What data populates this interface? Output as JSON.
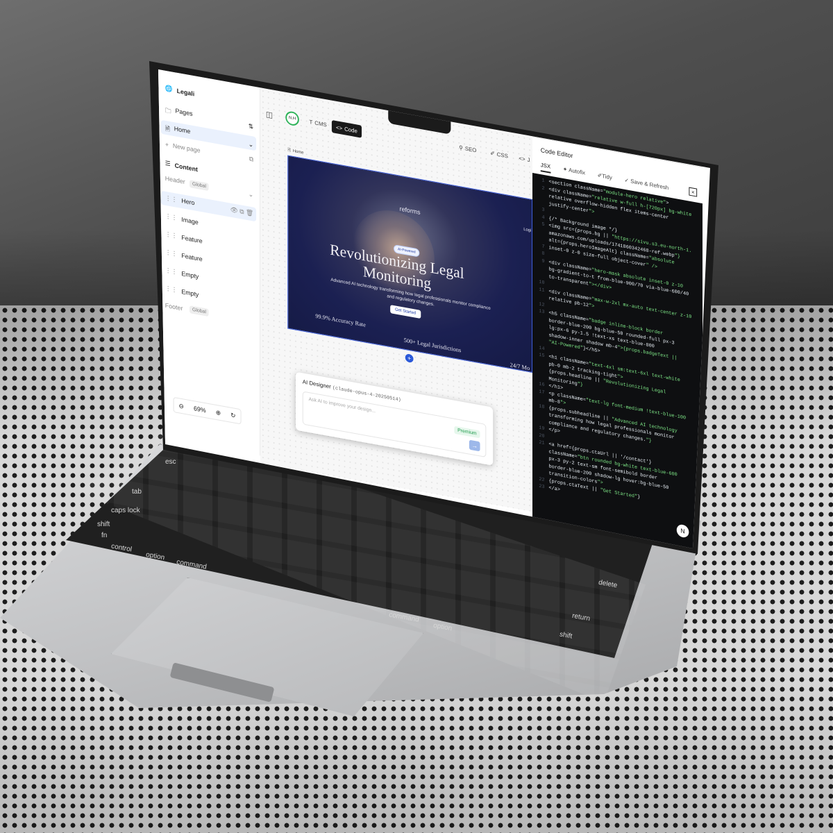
{
  "app": {
    "site_name": "Legali"
  },
  "sidebar": {
    "pages_label": "Pages",
    "home_label": "Home",
    "new_page_label": "New page",
    "content_label": "Content",
    "header_label": "Header",
    "footer_label": "Footer",
    "global_label": "Global",
    "layers": [
      "Hero",
      "Image",
      "Feature",
      "Feature",
      "Empty",
      "Empty"
    ],
    "zoom": "69%"
  },
  "topbar": {
    "avatar_initials": "N.H",
    "cms_label": "CMS",
    "code_label": "Code",
    "seo_label": "SEO",
    "css_label": "CSS",
    "js_label": "J"
  },
  "canvas": {
    "frame_label": "Home",
    "hero": {
      "brand": "reforms",
      "login": "Logi",
      "badge": "AI-Powered",
      "title_line1": "Revolutionizing Legal",
      "title_line2": "Monitoring",
      "subtitle": "Advanced AI technology transforming how legal professionals monitor compliance and regulatory changes.",
      "cta": "Get Started",
      "stats": [
        "99.9% Accuracy Rate",
        "500+ Legal Jurisdictions",
        "24/7 Mo"
      ]
    },
    "ai_designer": {
      "title": "AI Designer",
      "model": "(claude-opus-4-20250514)",
      "placeholder": "Ask AI to improve your design...",
      "premium": "Premium"
    }
  },
  "editor": {
    "title": "Code Editor",
    "tab_jsx": "JSX",
    "autofix": "Autofix",
    "tidy": "Tidy",
    "save_refresh": "Save & Refresh",
    "close": "×",
    "lines": [
      {
        "n": "1",
        "t": "<section className=\"module-hero relative\">"
      },
      {
        "n": "2",
        "t": "  <div className=\"relative w-full h-[720px] bg-white"
      },
      {
        "n": "",
        "t": "  relative overflow-hidden flex items-center"
      },
      {
        "n": "",
        "t": "  justify-center\">"
      },
      {
        "n": "3",
        "t": ""
      },
      {
        "n": "4",
        "t": "  {/* Background image */}"
      },
      {
        "n": "5",
        "t": "  <img src={props.bg || \"https://sivu.s3.eu-north-1."
      },
      {
        "n": "",
        "t": "  amazonaws.com/uploads/1741860342468-ref.webp\"}"
      },
      {
        "n": "",
        "t": "  alt={props.heroImageAlt} className=\"absolute"
      },
      {
        "n": "7",
        "t": "  inset-0 z-0 size-full object-cover\" />"
      },
      {
        "n": "8",
        "t": ""
      },
      {
        "n": "9",
        "t": "  <div className=\"hero-mask absolute inset-0 z-10"
      },
      {
        "n": "",
        "t": "  bg-gradient-to-t from-blue-900/70 via-blue-600/40"
      },
      {
        "n": "",
        "t": "  to-transparent\"></div>"
      },
      {
        "n": "10",
        "t": ""
      },
      {
        "n": "11",
        "t": "  <div className=\"max-w-2xl mx-auto text-center z-10"
      },
      {
        "n": "",
        "t": "  relative pb-12\">"
      },
      {
        "n": "12",
        "t": ""
      },
      {
        "n": "13",
        "t": "  <h5 className=\"badge inline-block border"
      },
      {
        "n": "",
        "t": "  border-blue-200 bg-blue-50 rounded-full px-3"
      },
      {
        "n": "",
        "t": "  lg:px-6 py-1.5 !text-xs text-blue-800"
      },
      {
        "n": "",
        "t": "  shadow-inner shadow mb-4\">{props.badgeText ||"
      },
      {
        "n": "",
        "t": "  \"AI-Powered\"}</h5>"
      },
      {
        "n": "14",
        "t": ""
      },
      {
        "n": "15",
        "t": "  <h1 className=\"text-4xl sm:text-6xl text-white"
      },
      {
        "n": "",
        "t": "  pb-0 mb-2 tracking-tight\">"
      },
      {
        "n": "",
        "t": "  {props.headline || \"Revolutionizing Legal"
      },
      {
        "n": "",
        "t": "  Monitoring\"}"
      },
      {
        "n": "16",
        "t": "  </h1>"
      },
      {
        "n": "17",
        "t": "  <p className=\"text-lg font-medium !text-blue-100"
      },
      {
        "n": "",
        "t": "  mb-8\">"
      },
      {
        "n": "18",
        "t": "  {props.subheadline || \"Advanced AI technology"
      },
      {
        "n": "",
        "t": "  transforming how legal professionals monitor"
      },
      {
        "n": "",
        "t": "  compliance and regulatory changes.\"}"
      },
      {
        "n": "19",
        "t": "  </p>"
      },
      {
        "n": "20",
        "t": ""
      },
      {
        "n": "21",
        "t": "  <a href={props.ctaUrl || '/contact'}"
      },
      {
        "n": "",
        "t": "  className=\"btn rounded bg-white text-blue-600"
      },
      {
        "n": "",
        "t": "  px-3 py-2 text-sm font-semibold border"
      },
      {
        "n": "",
        "t": "  border-blue-200 shadow-lg hover:bg-blue-50"
      },
      {
        "n": "",
        "t": "  transition-colors\">"
      },
      {
        "n": "22",
        "t": "  {props.ctaText || \"Get Started\"}"
      },
      {
        "n": "23",
        "t": "  </a>"
      }
    ]
  },
  "keyboard": {
    "labels": [
      "esc",
      "tab",
      "caps lock",
      "shift",
      "fn",
      "control",
      "option",
      "command",
      "command",
      "option",
      "return",
      "shift",
      "delete"
    ]
  },
  "badge_n": "N"
}
